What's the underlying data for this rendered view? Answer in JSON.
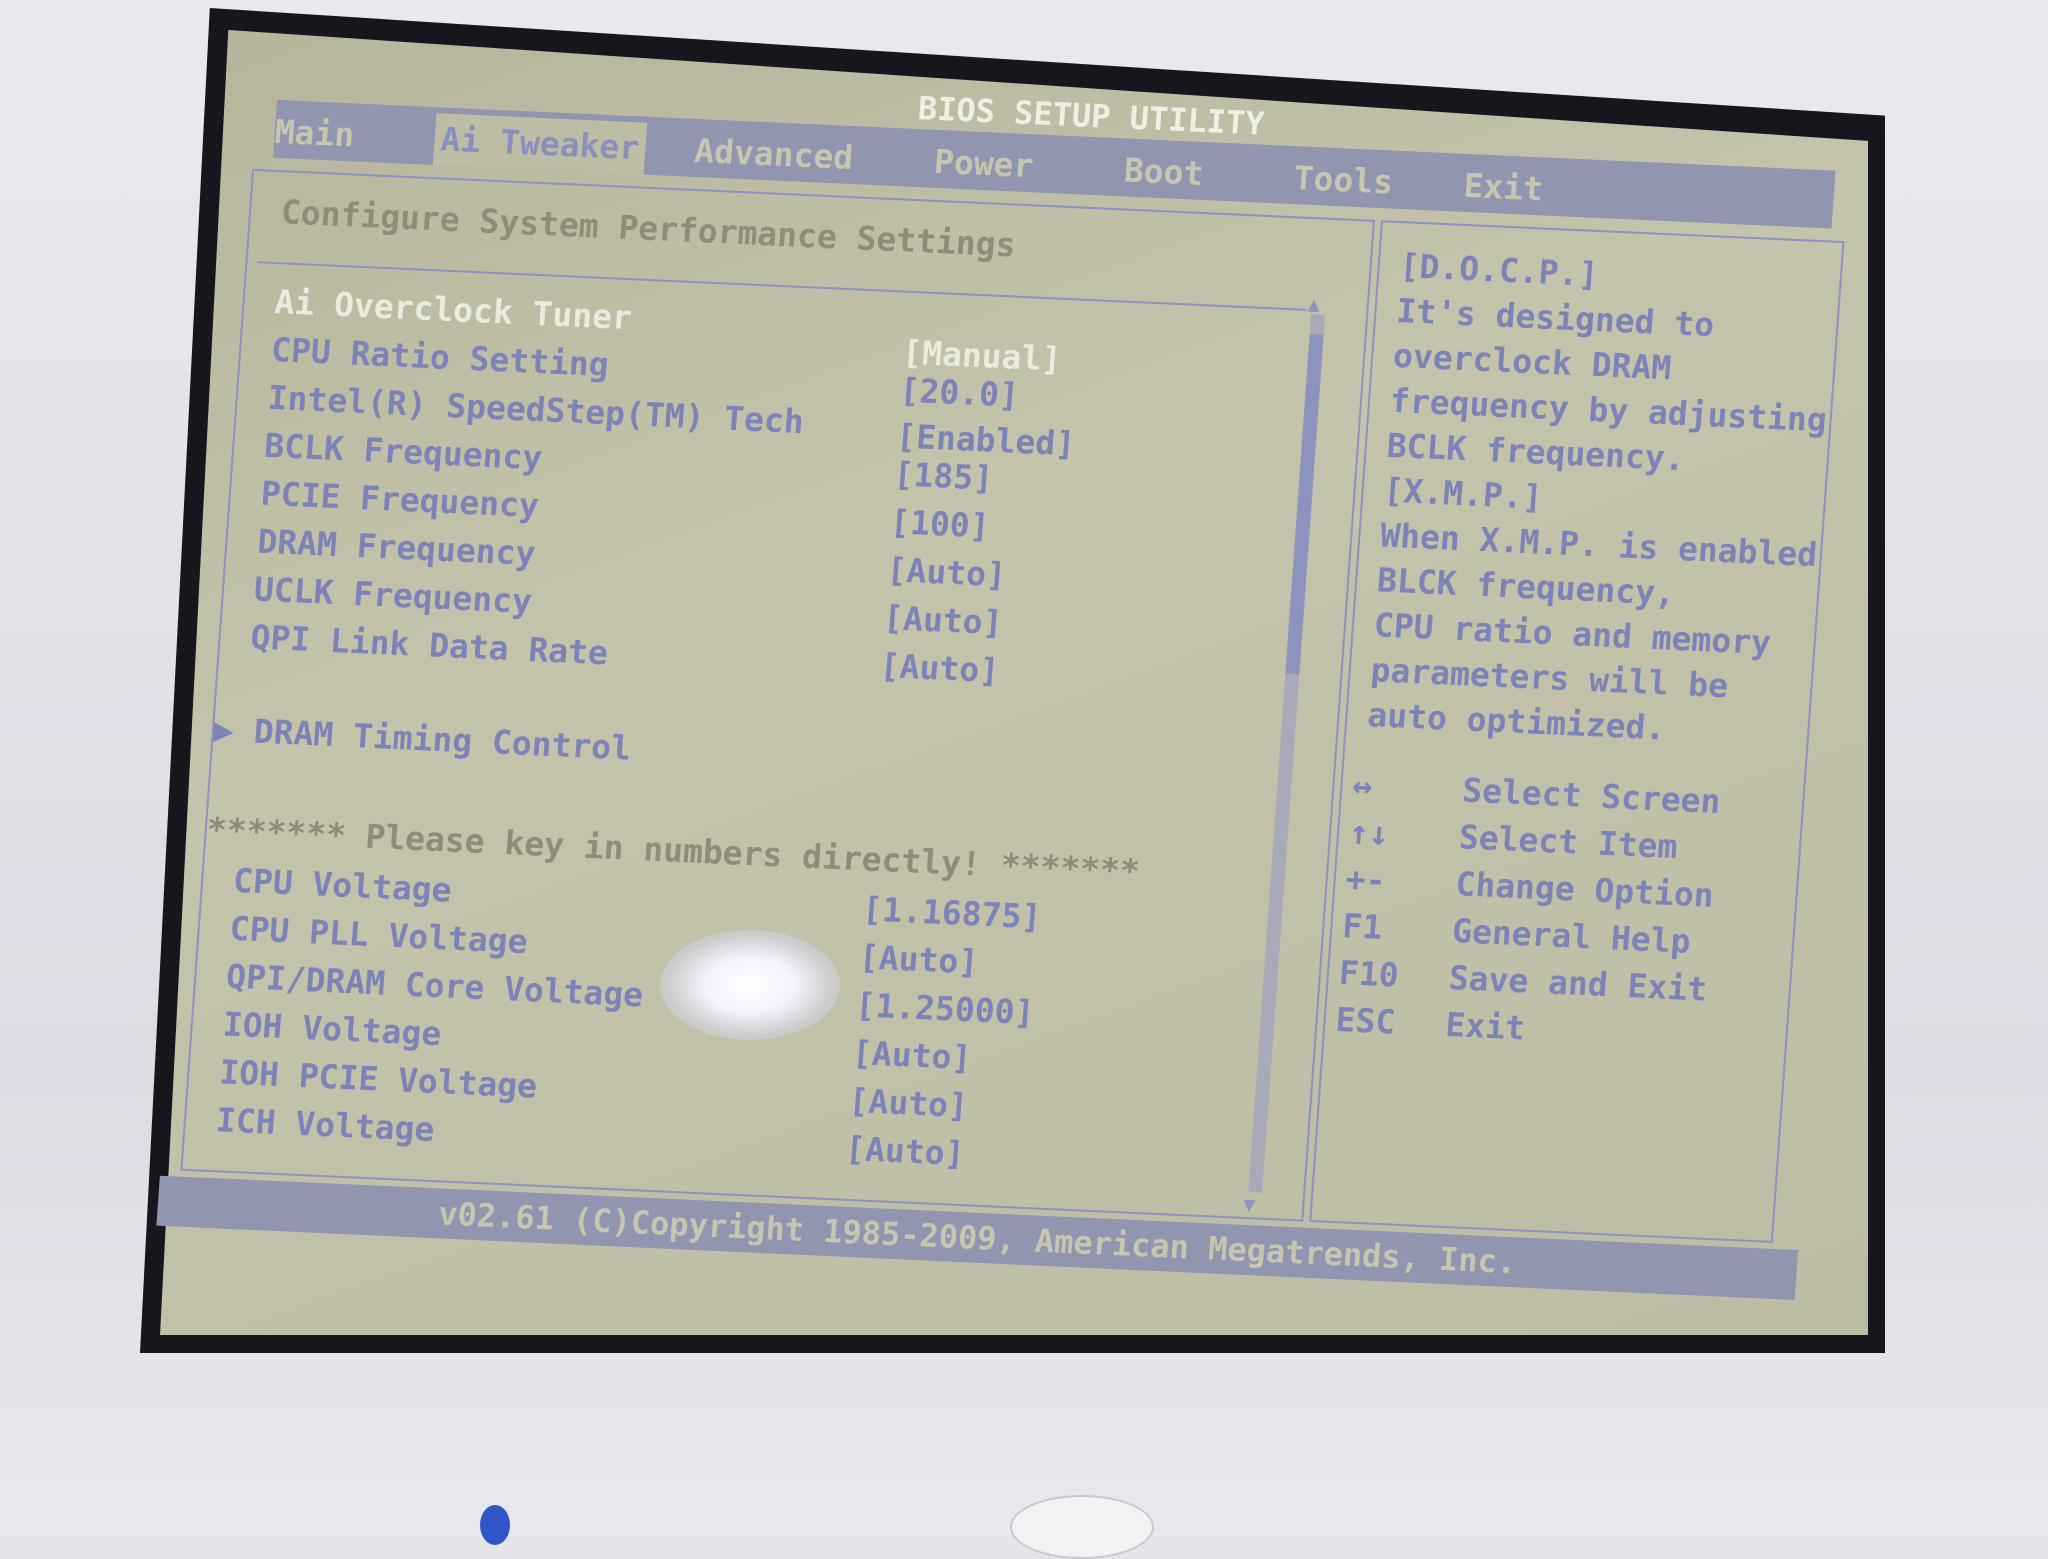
{
  "title": "BIOS SETUP UTILITY",
  "tabs": [
    {
      "label": "Main"
    },
    {
      "label": "Ai Tweaker",
      "selected": true
    },
    {
      "label": "Advanced"
    },
    {
      "label": "Power"
    },
    {
      "label": "Boot"
    },
    {
      "label": "Tools"
    },
    {
      "label": "Exit"
    }
  ],
  "panel": {
    "subtitle": "Configure System Performance Settings",
    "items": [
      {
        "label": "Ai Overclock Tuner",
        "value": "[Manual]"
      },
      {
        "label": "CPU Ratio Setting",
        "value": "[20.0]"
      },
      {
        "label": "Intel(R) SpeedStep(TM) Tech",
        "value": "[Enabled]"
      },
      {
        "label": "BCLK Frequency",
        "value": "[185]"
      },
      {
        "label": "PCIE Frequency",
        "value": "[100]"
      },
      {
        "label": "DRAM Frequency",
        "value": "[Auto]"
      },
      {
        "label": "UCLK Frequency",
        "value": "[Auto]"
      },
      {
        "label": "QPI Link Data Rate",
        "value": "[Auto]"
      }
    ],
    "submenu": "DRAM Timing Control",
    "submenu_marker": "▶",
    "notice": "******* Please key in numbers directly! *******",
    "voltages": [
      {
        "label": "CPU Voltage",
        "value": "[1.16875]"
      },
      {
        "label": "CPU PLL Voltage",
        "value": "[Auto]"
      },
      {
        "label": "QPI/DRAM Core Voltage",
        "value": "[1.25000]"
      },
      {
        "label": "IOH Voltage",
        "value": "[Auto]"
      },
      {
        "label": "IOH PCIE Voltage",
        "value": "[Auto]"
      },
      {
        "label": "ICH Voltage",
        "value": "[Auto]"
      }
    ]
  },
  "help": {
    "text": "[D.O.C.P.]\nIt's designed to\noverclock DRAM\nfrequency by adjusting\nBCLK frequency.\n[X.M.P.]\nWhen X.M.P. is enabled\nBLCK frequency,\nCPU ratio and memory\nparameters will be\nauto optimized.",
    "keys": [
      {
        "key": "↔",
        "action": "Select Screen"
      },
      {
        "key": "↑↓",
        "action": "Select Item"
      },
      {
        "key": "+-",
        "action": "Change Option"
      },
      {
        "key": "F1",
        "action": "General Help"
      },
      {
        "key": "F10",
        "action": "Save and Exit"
      },
      {
        "key": "ESC",
        "action": "Exit"
      }
    ]
  },
  "footer": "v02.61 (C)Copyright 1985-2009, American Megatrends, Inc.",
  "colors": {
    "text": "#7c83b6",
    "highlight": "#ecebdf",
    "bar": "#9095b0",
    "background": "#bdbca4"
  }
}
